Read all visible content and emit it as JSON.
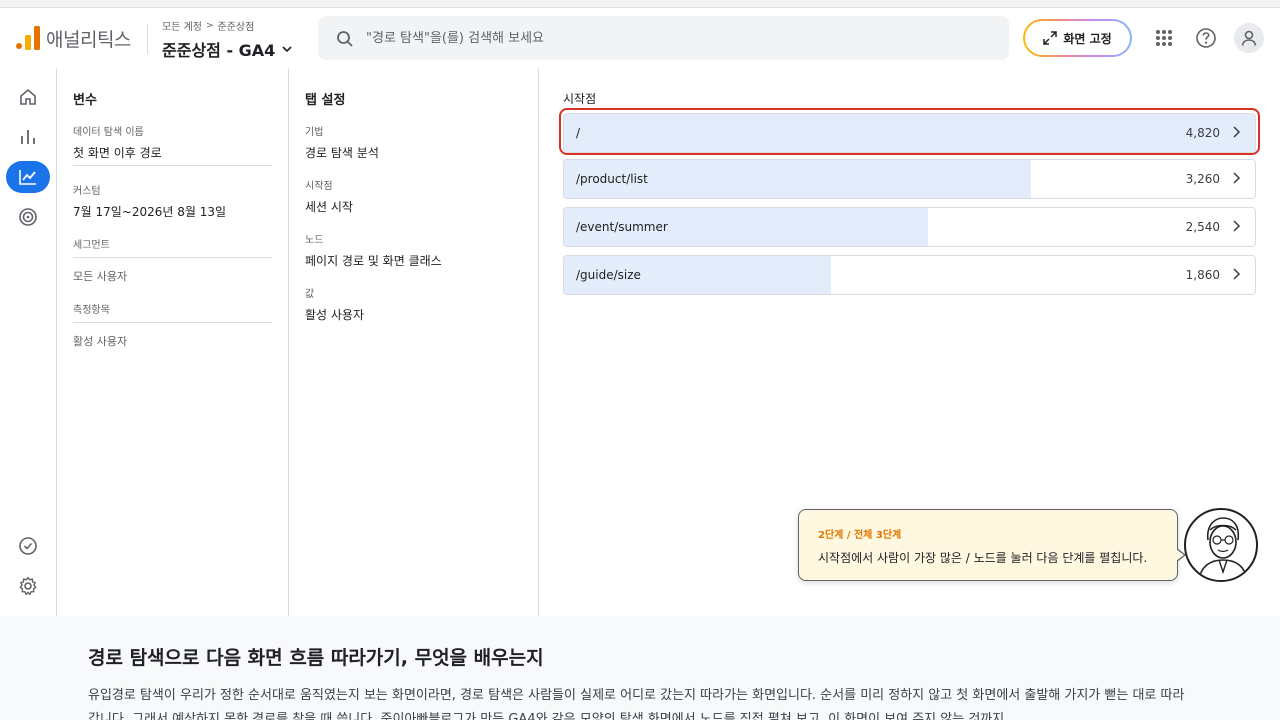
{
  "app": {
    "logo_text": "애널리틱스",
    "breadcrumb": [
      "모든 계정",
      "준준상점"
    ],
    "property": "준준상점 - GA4"
  },
  "search": {
    "placeholder": "\"경로 탐색\"을(를) 검색해 보세요"
  },
  "header": {
    "pin_label": "화면 고정"
  },
  "rail": {
    "items": [
      "home-icon",
      "reports-icon",
      "explore-icon",
      "advertising-icon",
      "checklist-icon",
      "settings-icon"
    ],
    "active": "explore-icon"
  },
  "variables": {
    "title": "변수",
    "exploration_name_label": "데이터 탐색 이름",
    "exploration_name": "첫 화면 이후 경로",
    "date_label": "커스텀",
    "date_range": "7월 17일~2026년 8월 13일",
    "segments_label": "세그먼트",
    "segment": "모든 사용자",
    "metrics_label": "측정항목",
    "metric": "활성 사용자"
  },
  "tab_settings": {
    "title": "탭 설정",
    "technique_label": "기법",
    "technique": "경로 탐색 분석",
    "start_label": "시작점",
    "start": "세션 시작",
    "node_label": "노드",
    "node": "페이지 경로 및 화면 클래스",
    "value_label": "값",
    "value": "활성 사용자"
  },
  "canvas": {
    "start_title": "시작점",
    "nodes": [
      {
        "label": "/",
        "count": "4,820",
        "share": 1.0
      },
      {
        "label": "/product/list",
        "count": "3,260",
        "share": 0.676
      },
      {
        "label": "/event/summer",
        "count": "2,540",
        "share": 0.527
      },
      {
        "label": "/guide/size",
        "count": "1,860",
        "share": 0.386
      }
    ]
  },
  "tooltip": {
    "step": "2단계 / 전체 3단계",
    "text": "시작점에서 사람이 가장 많은 / 노드를 눌러 다음 단계를 펼칩니다."
  },
  "article": {
    "title": "경로 탐색으로 다음 화면 흐름 따라가기, 무엇을 배우는지",
    "body": "유입경로 탐색이 우리가 정한 순서대로 움직였는지 보는 화면이라면, 경로 탐색은 사람들이 실제로 어디로 갔는지 따라가는 화면입니다. 순서를 미리 정하지 않고 첫 화면에서 출발해 가지가 뻗는 대로 따라갑니다. 그래서 예상하지 못한 경로를 찾을 때 씁니다. 준이아빠블로그가 만든 GA4와 같은 모양의 탐색 화면에서 노드를 직접 펼쳐 보고, 이 화면이 보여 주지 않는 것까지"
  }
}
